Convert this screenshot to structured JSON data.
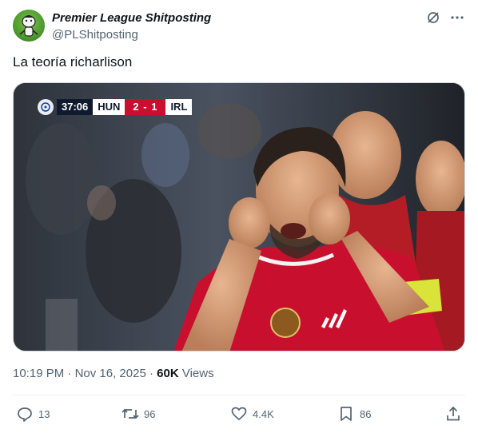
{
  "author": {
    "display_name": "Premier League Shitposting",
    "handle": "@PLShitposting",
    "avatar_icon": "cartoon-character-avatar"
  },
  "header_icons": [
    "grok-icon",
    "more-icon"
  ],
  "tweet": {
    "text": "La teoría richarlison"
  },
  "scoreboard": {
    "time": "37:06",
    "home": "HUN",
    "score": "2 - 1",
    "away": "IRL"
  },
  "meta": {
    "time": "10:19 PM",
    "separator1": "·",
    "date": "Nov 16, 2025",
    "separator2": "·",
    "views_count": "60K",
    "views_label": "Views"
  },
  "actions": {
    "replies": "13",
    "reposts": "96",
    "likes": "4.4K",
    "bookmarks": "86"
  },
  "colors": {
    "text_primary": "#0f1419",
    "text_secondary": "#536471",
    "hungary_red": "#c8102e"
  }
}
